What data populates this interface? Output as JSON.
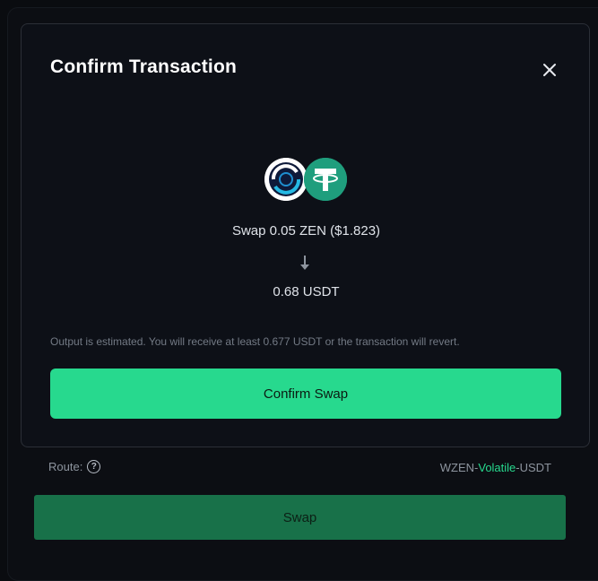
{
  "modal": {
    "title": "Confirm Transaction",
    "from_token": "ZEN",
    "to_token": "USDT",
    "swap_from_text": "Swap 0.05 ZEN ($1.823)",
    "swap_to_text": "0.68 USDT",
    "notice": "Output is estimated. You will receive at least 0.677 USDT or the transaction will revert.",
    "confirm_label": "Confirm Swap"
  },
  "route": {
    "label": "Route:",
    "path_start": "WZEN-",
    "path_middle": "Volatile",
    "path_end": "-USDT"
  },
  "swap_button": {
    "label": "Swap"
  },
  "colors": {
    "accent": "#27d98e",
    "swap_button": "#187149",
    "usdt": "#1f9e7d",
    "background": "#0a0c10"
  },
  "icons": [
    "close-icon",
    "zen-token-icon",
    "usdt-token-icon",
    "arrow-down-icon",
    "help-icon"
  ]
}
